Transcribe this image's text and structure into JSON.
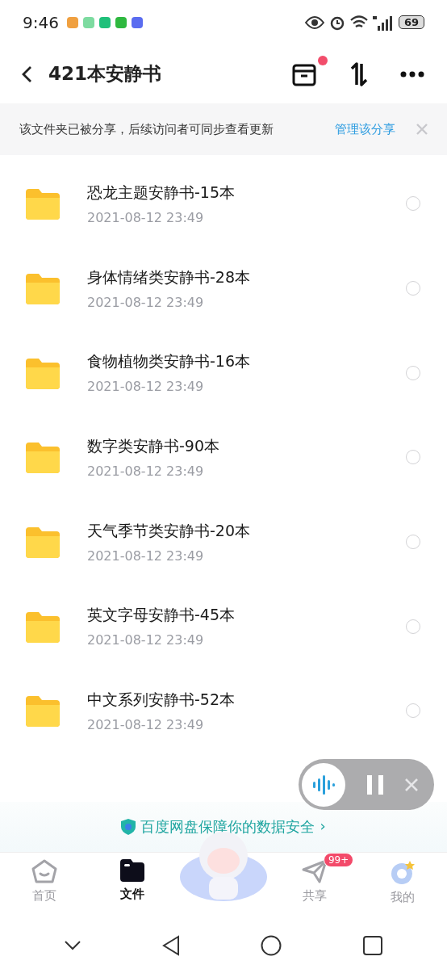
{
  "status_bar": {
    "time": "9:46",
    "battery": "69"
  },
  "header": {
    "title": "421本安静书",
    "has_notification": true
  },
  "share_banner": {
    "text": "该文件夹已被分享，后续访问者可同步查看更新",
    "link": "管理该分享"
  },
  "folders": [
    {
      "name": "恐龙主题安静书-15本",
      "date": "2021-08-12  23:49",
      "selected": false
    },
    {
      "name": "身体情绪类安静书-28本",
      "date": "2021-08-12  23:49",
      "selected": false
    },
    {
      "name": "食物植物类安静书-16本",
      "date": "2021-08-12  23:49",
      "selected": false
    },
    {
      "name": "数字类安静书-90本",
      "date": "2021-08-12  23:49",
      "selected": false
    },
    {
      "name": "天气季节类安静书-20本",
      "date": "2021-08-12  23:49",
      "selected": false
    },
    {
      "name": "英文字母安静书-45本",
      "date": "2021-08-12  23:49",
      "selected": false
    },
    {
      "name": "中文系列安静书-52本",
      "date": "2021-08-12  23:49",
      "selected": false
    }
  ],
  "security_banner": {
    "text": "百度网盘保障你的数据安全",
    "arrow": "›"
  },
  "tabs": [
    {
      "kind": "home",
      "label": "首页",
      "selected": false
    },
    {
      "kind": "files",
      "label": "文件",
      "selected": true
    },
    {
      "kind": "mascot"
    },
    {
      "kind": "share",
      "label": "共享",
      "selected": false,
      "badge": "99+"
    },
    {
      "kind": "me",
      "label": "我的",
      "selected": false
    }
  ]
}
